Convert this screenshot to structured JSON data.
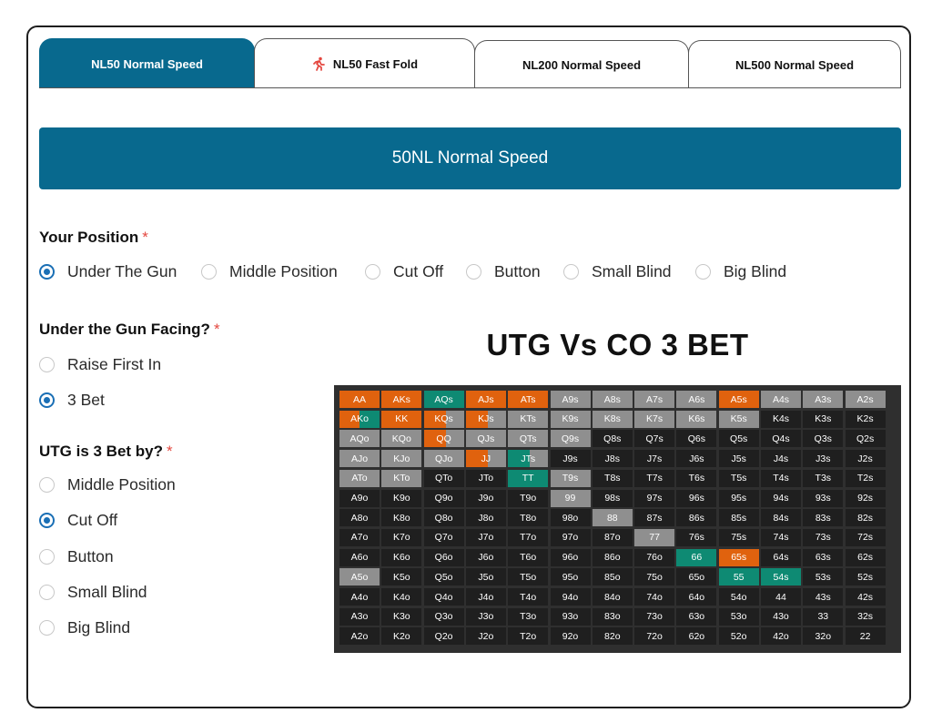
{
  "tabs": [
    {
      "label": "NL50 Normal Speed",
      "icon": "",
      "active": true
    },
    {
      "label": "NL50 Fast Fold",
      "icon": "running-icon",
      "active": false
    },
    {
      "label": "NL200 Normal Speed",
      "icon": "",
      "active": false
    },
    {
      "label": "NL500 Normal Speed",
      "icon": "",
      "active": false
    }
  ],
  "banner": {
    "title": "50NL Normal Speed"
  },
  "position": {
    "question": "Your Position",
    "required": "*",
    "options": [
      "Under The Gun",
      "Middle Position",
      "Cut Off",
      "Button",
      "Small Blind",
      "Big Blind"
    ],
    "selected": 0
  },
  "facing": {
    "question": "Under the Gun Facing?",
    "required": "*",
    "options": [
      "Raise First In",
      "3 Bet"
    ],
    "selected": 1
  },
  "threebet": {
    "question": "UTG is 3 Bet by?",
    "required": "*",
    "options": [
      "Middle Position",
      "Cut Off",
      "Button",
      "Small Blind",
      "Big Blind"
    ],
    "selected": 1
  },
  "chart": {
    "title": "UTG Vs CO 3 BET"
  },
  "colors": {
    "accent": "#08698e",
    "radio": "#1a6fb5",
    "required": "#e4473f",
    "orange": "#e0620e",
    "teal": "#0e8a73",
    "gray": "#8f8f8f",
    "dark": "#1f1f1f"
  },
  "chart_data": {
    "type": "table",
    "title": "UTG Vs CO 3 BET",
    "ranks": [
      "A",
      "K",
      "Q",
      "J",
      "T",
      "9",
      "8",
      "7",
      "6",
      "5",
      "4",
      "3",
      "2"
    ],
    "legend": {
      "o": "orange",
      "t": "teal",
      "g": "gray",
      "d": "dark",
      "og": "orange/gray mixed",
      "tg": "teal/gray mixed",
      "ot": "orange/teal mixed"
    },
    "rows": [
      {
        "hands": [
          "AA",
          "AKs",
          "AQs",
          "AJs",
          "ATs",
          "A9s",
          "A8s",
          "A7s",
          "A6s",
          "A5s",
          "A4s",
          "A3s",
          "A2s"
        ],
        "colors": [
          "o",
          "o",
          "t",
          "o",
          "o",
          "g",
          "g",
          "g",
          "g",
          "o",
          "g",
          "g",
          "g"
        ]
      },
      {
        "hands": [
          "AKo",
          "KK",
          "KQs",
          "KJs",
          "KTs",
          "K9s",
          "K8s",
          "K7s",
          "K6s",
          "K5s",
          "K4s",
          "K3s",
          "K2s"
        ],
        "colors": [
          "ot",
          "o",
          "og",
          "og",
          "g",
          "g",
          "g",
          "g",
          "g",
          "g",
          "d",
          "d",
          "d"
        ]
      },
      {
        "hands": [
          "AQo",
          "KQo",
          "QQ",
          "QJs",
          "QTs",
          "Q9s",
          "Q8s",
          "Q7s",
          "Q6s",
          "Q5s",
          "Q4s",
          "Q3s",
          "Q2s"
        ],
        "colors": [
          "g",
          "g",
          "og",
          "g",
          "g",
          "g",
          "d",
          "d",
          "d",
          "d",
          "d",
          "d",
          "d"
        ]
      },
      {
        "hands": [
          "AJo",
          "KJo",
          "QJo",
          "JJ",
          "JTs",
          "J9s",
          "J8s",
          "J7s",
          "J6s",
          "J5s",
          "J4s",
          "J3s",
          "J2s"
        ],
        "colors": [
          "g",
          "g",
          "g",
          "og",
          "tg",
          "d",
          "d",
          "d",
          "d",
          "d",
          "d",
          "d",
          "d"
        ]
      },
      {
        "hands": [
          "ATo",
          "KTo",
          "QTo",
          "JTo",
          "TT",
          "T9s",
          "T8s",
          "T7s",
          "T6s",
          "T5s",
          "T4s",
          "T3s",
          "T2s"
        ],
        "colors": [
          "g",
          "g",
          "d",
          "d",
          "t",
          "g",
          "d",
          "d",
          "d",
          "d",
          "d",
          "d",
          "d"
        ]
      },
      {
        "hands": [
          "A9o",
          "K9o",
          "Q9o",
          "J9o",
          "T9o",
          "99",
          "98s",
          "97s",
          "96s",
          "95s",
          "94s",
          "93s",
          "92s"
        ],
        "colors": [
          "d",
          "d",
          "d",
          "d",
          "d",
          "g",
          "d",
          "d",
          "d",
          "d",
          "d",
          "d",
          "d"
        ]
      },
      {
        "hands": [
          "A8o",
          "K8o",
          "Q8o",
          "J8o",
          "T8o",
          "98o",
          "88",
          "87s",
          "86s",
          "85s",
          "84s",
          "83s",
          "82s"
        ],
        "colors": [
          "d",
          "d",
          "d",
          "d",
          "d",
          "d",
          "g",
          "d",
          "d",
          "d",
          "d",
          "d",
          "d"
        ]
      },
      {
        "hands": [
          "A7o",
          "K7o",
          "Q7o",
          "J7o",
          "T7o",
          "97o",
          "87o",
          "77",
          "76s",
          "75s",
          "74s",
          "73s",
          "72s"
        ],
        "colors": [
          "d",
          "d",
          "d",
          "d",
          "d",
          "d",
          "d",
          "g",
          "d",
          "d",
          "d",
          "d",
          "d"
        ]
      },
      {
        "hands": [
          "A6o",
          "K6o",
          "Q6o",
          "J6o",
          "T6o",
          "96o",
          "86o",
          "76o",
          "66",
          "65s",
          "64s",
          "63s",
          "62s"
        ],
        "colors": [
          "d",
          "d",
          "d",
          "d",
          "d",
          "d",
          "d",
          "d",
          "t",
          "o",
          "d",
          "d",
          "d"
        ]
      },
      {
        "hands": [
          "A5o",
          "K5o",
          "Q5o",
          "J5o",
          "T5o",
          "95o",
          "85o",
          "75o",
          "65o",
          "55",
          "54s",
          "53s",
          "52s"
        ],
        "colors": [
          "g",
          "d",
          "d",
          "d",
          "d",
          "d",
          "d",
          "d",
          "d",
          "t",
          "t",
          "d",
          "d"
        ]
      },
      {
        "hands": [
          "A4o",
          "K4o",
          "Q4o",
          "J4o",
          "T4o",
          "94o",
          "84o",
          "74o",
          "64o",
          "54o",
          "44",
          "43s",
          "42s"
        ],
        "colors": [
          "d",
          "d",
          "d",
          "d",
          "d",
          "d",
          "d",
          "d",
          "d",
          "d",
          "d",
          "d",
          "d"
        ]
      },
      {
        "hands": [
          "A3o",
          "K3o",
          "Q3o",
          "J3o",
          "T3o",
          "93o",
          "83o",
          "73o",
          "63o",
          "53o",
          "43o",
          "33",
          "32s"
        ],
        "colors": [
          "d",
          "d",
          "d",
          "d",
          "d",
          "d",
          "d",
          "d",
          "d",
          "d",
          "d",
          "d",
          "d"
        ]
      },
      {
        "hands": [
          "A2o",
          "K2o",
          "Q2o",
          "J2o",
          "T2o",
          "92o",
          "82o",
          "72o",
          "62o",
          "52o",
          "42o",
          "32o",
          "22"
        ],
        "colors": [
          "d",
          "d",
          "d",
          "d",
          "d",
          "d",
          "d",
          "d",
          "d",
          "d",
          "d",
          "d",
          "d"
        ]
      }
    ]
  }
}
